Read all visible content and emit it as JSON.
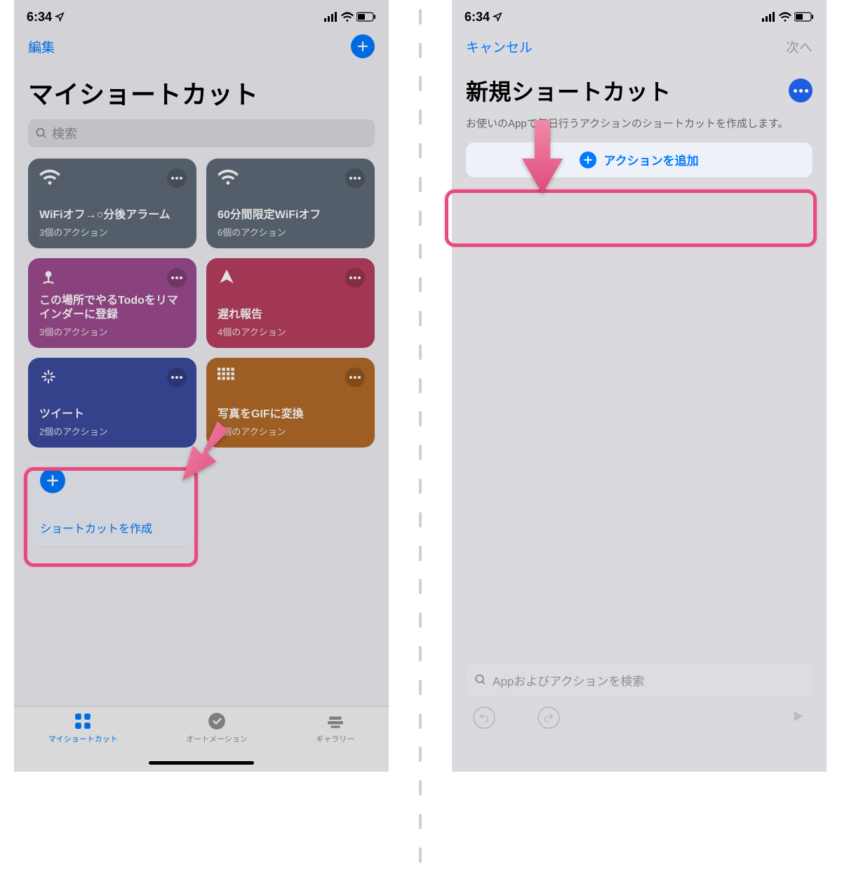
{
  "status": {
    "time": "6:34"
  },
  "left": {
    "nav_edit": "編集",
    "title": "マイショートカット",
    "search_placeholder": "検索",
    "tiles": [
      {
        "name": "WiFiオフ→○分後アラーム",
        "sub": "3個のアクション",
        "color": "#5f6b7a",
        "icon": "wifi"
      },
      {
        "name": "60分間限定WiFiオフ",
        "sub": "6個のアクション",
        "color": "#5f6b7a",
        "icon": "wifi"
      },
      {
        "name": "この場所でやるTodoをリマインダーに登録",
        "sub": "3個のアクション",
        "color": "#9d4b8f",
        "icon": "pin"
      },
      {
        "name": "遅れ報告",
        "sub": "4個のアクション",
        "color": "#b73f5d",
        "icon": "send"
      },
      {
        "name": "ツイート",
        "sub": "2個のアクション",
        "color": "#3b4a9e",
        "icon": "sparkle"
      },
      {
        "name": "写真をGIFに変換",
        "sub": "4個のアクション",
        "color": "#b46a27",
        "icon": "grid"
      }
    ],
    "create_label": "ショートカットを作成",
    "tabs": [
      {
        "label": "マイショートカット",
        "active": true
      },
      {
        "label": "オートメーション",
        "active": false
      },
      {
        "label": "ギャラリー",
        "active": false
      }
    ]
  },
  "right": {
    "nav_cancel": "キャンセル",
    "nav_next": "次へ",
    "title": "新規ショートカット",
    "desc": "お使いのAppで毎日行うアクションのショートカットを作成します。",
    "add_action": "アクションを追加",
    "search_placeholder": "Appおよびアクションを検索"
  }
}
